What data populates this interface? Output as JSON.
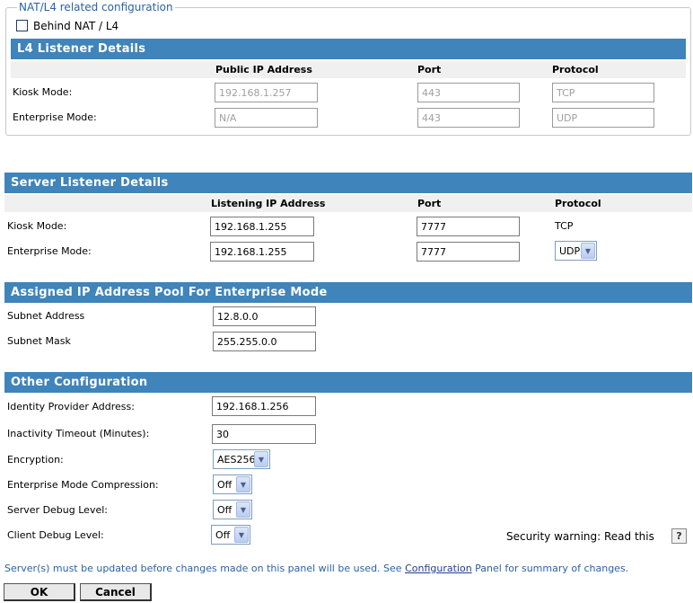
{
  "nat": {
    "legend": "NAT/L4 related configuration",
    "behind_label": "Behind NAT / L4",
    "behind_checked": false
  },
  "l4": {
    "title": "L4 Listener Details",
    "headers": {
      "ip": "Public IP Address",
      "port": "Port",
      "protocol": "Protocol"
    },
    "kiosk": {
      "label": "Kiosk Mode:",
      "ip": "192.168.1.257",
      "port": "443",
      "protocol": "TCP"
    },
    "enterprise": {
      "label": "Enterprise Mode:",
      "ip": "N/A",
      "port": "443",
      "protocol": "UDP"
    }
  },
  "server": {
    "title": "Server Listener Details",
    "headers": {
      "ip": "Listening IP Address",
      "port": "Port",
      "protocol": "Protocol"
    },
    "kiosk": {
      "label": "Kiosk Mode:",
      "ip": "192.168.1.255",
      "port": "7777",
      "protocol": "TCP"
    },
    "enterprise": {
      "label": "Enterprise Mode:",
      "ip": "192.168.1.255",
      "port": "7777",
      "protocol": "UDP"
    }
  },
  "pool": {
    "title": "Assigned IP Address Pool For Enterprise Mode",
    "subnet_address_label": "Subnet Address",
    "subnet_address": "12.8.0.0",
    "subnet_mask_label": "Subnet Mask",
    "subnet_mask": "255.255.0.0"
  },
  "other": {
    "title": "Other Configuration",
    "idp_label": "Identity Provider Address:",
    "idp": "192.168.1.256",
    "timeout_label": "Inactivity Timeout (Minutes):",
    "timeout": "30",
    "encryption_label": "Encryption:",
    "encryption": "AES256",
    "compression_label": "Enterprise Mode Compression:",
    "compression": "Off",
    "server_debug_label": "Server Debug Level:",
    "server_debug": "Off",
    "client_debug_label": "Client Debug Level:",
    "client_debug": "Off",
    "security_warning": "Security warning: Read this",
    "help_glyph": "?"
  },
  "footer": {
    "note_before": "Server(s) must be updated before changes made on this panel will be used. See ",
    "note_link": "Configuration",
    "note_after": " Panel for summary of changes.",
    "ok_label": "OK",
    "cancel_label": "Cancel"
  },
  "colors": {
    "accent": "#3f84ba",
    "legend": "#2a62a8"
  }
}
